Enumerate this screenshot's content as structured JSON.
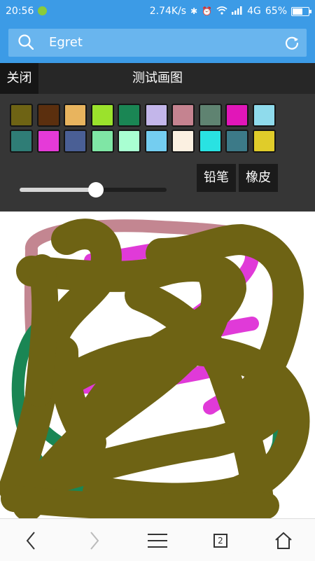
{
  "statusbar": {
    "time": "20:56",
    "network_speed": "2.74K/s",
    "network_type": "4G",
    "battery": "65%",
    "icons": [
      "bluetooth-icon",
      "alarm-icon",
      "wifi-icon",
      "signal-icon",
      "battery-icon"
    ]
  },
  "search": {
    "text": "Egret",
    "search_icon": "search-icon",
    "refresh_icon": "refresh-icon"
  },
  "panel": {
    "close_label": "关闭",
    "title": "测试画图",
    "pencil_label": "铅笔",
    "eraser_label": "橡皮",
    "brush_size_fraction": 0.52,
    "palette": [
      "#6e6314",
      "#5b2f0e",
      "#e8b45e",
      "#9be22c",
      "#1a8654",
      "#c3b6ea",
      "#c58390",
      "#5f8371",
      "#e116b8",
      "#8fdbec",
      "#2f7d76",
      "#e53ad8",
      "#4a5f95",
      "#7fe6a5",
      "#a9ffd2",
      "#74cdf0",
      "#fbf0e1",
      "#29e2e2",
      "#3c7a88",
      "#e0cc2a"
    ]
  },
  "drawing": {
    "stroke_colors": [
      "#c38691",
      "#e03ad8",
      "#1a8654",
      "#6e6314"
    ]
  },
  "navbar": {
    "tab_count": "2",
    "icons": [
      "back-icon",
      "forward-icon",
      "menu-icon",
      "tabs-icon",
      "home-icon"
    ]
  }
}
